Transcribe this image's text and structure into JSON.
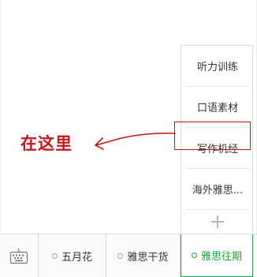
{
  "submenu": {
    "items": [
      {
        "label": "听力训练"
      },
      {
        "label": "口语素材"
      },
      {
        "label": "写作机经"
      },
      {
        "label": "海外雅思..."
      }
    ],
    "add_icon": "plus-icon"
  },
  "annotation": {
    "text": "在这里",
    "color": "#c8161d"
  },
  "menubar": {
    "keyboard_icon": "keyboard-icon",
    "tabs": [
      {
        "label": "五月花"
      },
      {
        "label": "雅思干货"
      },
      {
        "label": "雅思往期",
        "active": true
      }
    ],
    "active_color": "#24a140"
  }
}
